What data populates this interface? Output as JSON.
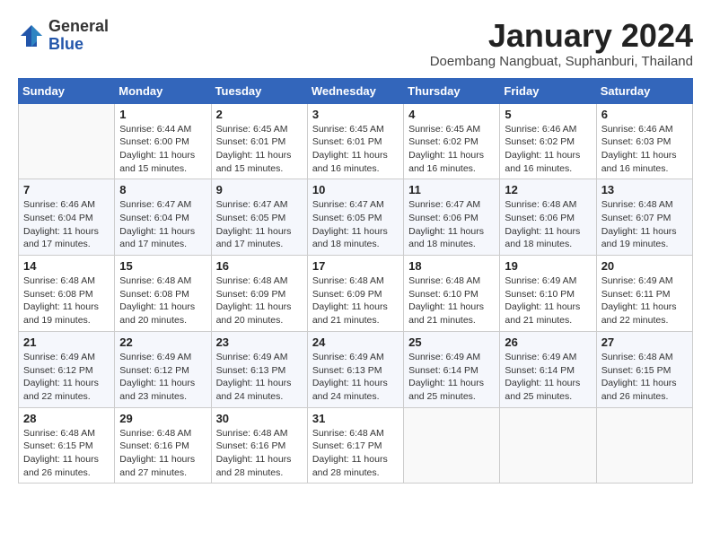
{
  "header": {
    "logo_general": "General",
    "logo_blue": "Blue",
    "month": "January 2024",
    "location": "Doembang Nangbuat, Suphanburi, Thailand"
  },
  "weekdays": [
    "Sunday",
    "Monday",
    "Tuesday",
    "Wednesday",
    "Thursday",
    "Friday",
    "Saturday"
  ],
  "weeks": [
    [
      {
        "day": "",
        "sunrise": "",
        "sunset": "",
        "daylight": ""
      },
      {
        "day": "1",
        "sunrise": "Sunrise: 6:44 AM",
        "sunset": "Sunset: 6:00 PM",
        "daylight": "Daylight: 11 hours and 15 minutes."
      },
      {
        "day": "2",
        "sunrise": "Sunrise: 6:45 AM",
        "sunset": "Sunset: 6:01 PM",
        "daylight": "Daylight: 11 hours and 15 minutes."
      },
      {
        "day": "3",
        "sunrise": "Sunrise: 6:45 AM",
        "sunset": "Sunset: 6:01 PM",
        "daylight": "Daylight: 11 hours and 16 minutes."
      },
      {
        "day": "4",
        "sunrise": "Sunrise: 6:45 AM",
        "sunset": "Sunset: 6:02 PM",
        "daylight": "Daylight: 11 hours and 16 minutes."
      },
      {
        "day": "5",
        "sunrise": "Sunrise: 6:46 AM",
        "sunset": "Sunset: 6:02 PM",
        "daylight": "Daylight: 11 hours and 16 minutes."
      },
      {
        "day": "6",
        "sunrise": "Sunrise: 6:46 AM",
        "sunset": "Sunset: 6:03 PM",
        "daylight": "Daylight: 11 hours and 16 minutes."
      }
    ],
    [
      {
        "day": "7",
        "sunrise": "Sunrise: 6:46 AM",
        "sunset": "Sunset: 6:04 PM",
        "daylight": "Daylight: 11 hours and 17 minutes."
      },
      {
        "day": "8",
        "sunrise": "Sunrise: 6:47 AM",
        "sunset": "Sunset: 6:04 PM",
        "daylight": "Daylight: 11 hours and 17 minutes."
      },
      {
        "day": "9",
        "sunrise": "Sunrise: 6:47 AM",
        "sunset": "Sunset: 6:05 PM",
        "daylight": "Daylight: 11 hours and 17 minutes."
      },
      {
        "day": "10",
        "sunrise": "Sunrise: 6:47 AM",
        "sunset": "Sunset: 6:05 PM",
        "daylight": "Daylight: 11 hours and 18 minutes."
      },
      {
        "day": "11",
        "sunrise": "Sunrise: 6:47 AM",
        "sunset": "Sunset: 6:06 PM",
        "daylight": "Daylight: 11 hours and 18 minutes."
      },
      {
        "day": "12",
        "sunrise": "Sunrise: 6:48 AM",
        "sunset": "Sunset: 6:06 PM",
        "daylight": "Daylight: 11 hours and 18 minutes."
      },
      {
        "day": "13",
        "sunrise": "Sunrise: 6:48 AM",
        "sunset": "Sunset: 6:07 PM",
        "daylight": "Daylight: 11 hours and 19 minutes."
      }
    ],
    [
      {
        "day": "14",
        "sunrise": "Sunrise: 6:48 AM",
        "sunset": "Sunset: 6:08 PM",
        "daylight": "Daylight: 11 hours and 19 minutes."
      },
      {
        "day": "15",
        "sunrise": "Sunrise: 6:48 AM",
        "sunset": "Sunset: 6:08 PM",
        "daylight": "Daylight: 11 hours and 20 minutes."
      },
      {
        "day": "16",
        "sunrise": "Sunrise: 6:48 AM",
        "sunset": "Sunset: 6:09 PM",
        "daylight": "Daylight: 11 hours and 20 minutes."
      },
      {
        "day": "17",
        "sunrise": "Sunrise: 6:48 AM",
        "sunset": "Sunset: 6:09 PM",
        "daylight": "Daylight: 11 hours and 21 minutes."
      },
      {
        "day": "18",
        "sunrise": "Sunrise: 6:48 AM",
        "sunset": "Sunset: 6:10 PM",
        "daylight": "Daylight: 11 hours and 21 minutes."
      },
      {
        "day": "19",
        "sunrise": "Sunrise: 6:49 AM",
        "sunset": "Sunset: 6:10 PM",
        "daylight": "Daylight: 11 hours and 21 minutes."
      },
      {
        "day": "20",
        "sunrise": "Sunrise: 6:49 AM",
        "sunset": "Sunset: 6:11 PM",
        "daylight": "Daylight: 11 hours and 22 minutes."
      }
    ],
    [
      {
        "day": "21",
        "sunrise": "Sunrise: 6:49 AM",
        "sunset": "Sunset: 6:12 PM",
        "daylight": "Daylight: 11 hours and 22 minutes."
      },
      {
        "day": "22",
        "sunrise": "Sunrise: 6:49 AM",
        "sunset": "Sunset: 6:12 PM",
        "daylight": "Daylight: 11 hours and 23 minutes."
      },
      {
        "day": "23",
        "sunrise": "Sunrise: 6:49 AM",
        "sunset": "Sunset: 6:13 PM",
        "daylight": "Daylight: 11 hours and 24 minutes."
      },
      {
        "day": "24",
        "sunrise": "Sunrise: 6:49 AM",
        "sunset": "Sunset: 6:13 PM",
        "daylight": "Daylight: 11 hours and 24 minutes."
      },
      {
        "day": "25",
        "sunrise": "Sunrise: 6:49 AM",
        "sunset": "Sunset: 6:14 PM",
        "daylight": "Daylight: 11 hours and 25 minutes."
      },
      {
        "day": "26",
        "sunrise": "Sunrise: 6:49 AM",
        "sunset": "Sunset: 6:14 PM",
        "daylight": "Daylight: 11 hours and 25 minutes."
      },
      {
        "day": "27",
        "sunrise": "Sunrise: 6:48 AM",
        "sunset": "Sunset: 6:15 PM",
        "daylight": "Daylight: 11 hours and 26 minutes."
      }
    ],
    [
      {
        "day": "28",
        "sunrise": "Sunrise: 6:48 AM",
        "sunset": "Sunset: 6:15 PM",
        "daylight": "Daylight: 11 hours and 26 minutes."
      },
      {
        "day": "29",
        "sunrise": "Sunrise: 6:48 AM",
        "sunset": "Sunset: 6:16 PM",
        "daylight": "Daylight: 11 hours and 27 minutes."
      },
      {
        "day": "30",
        "sunrise": "Sunrise: 6:48 AM",
        "sunset": "Sunset: 6:16 PM",
        "daylight": "Daylight: 11 hours and 28 minutes."
      },
      {
        "day": "31",
        "sunrise": "Sunrise: 6:48 AM",
        "sunset": "Sunset: 6:17 PM",
        "daylight": "Daylight: 11 hours and 28 minutes."
      },
      {
        "day": "",
        "sunrise": "",
        "sunset": "",
        "daylight": ""
      },
      {
        "day": "",
        "sunrise": "",
        "sunset": "",
        "daylight": ""
      },
      {
        "day": "",
        "sunrise": "",
        "sunset": "",
        "daylight": ""
      }
    ]
  ]
}
